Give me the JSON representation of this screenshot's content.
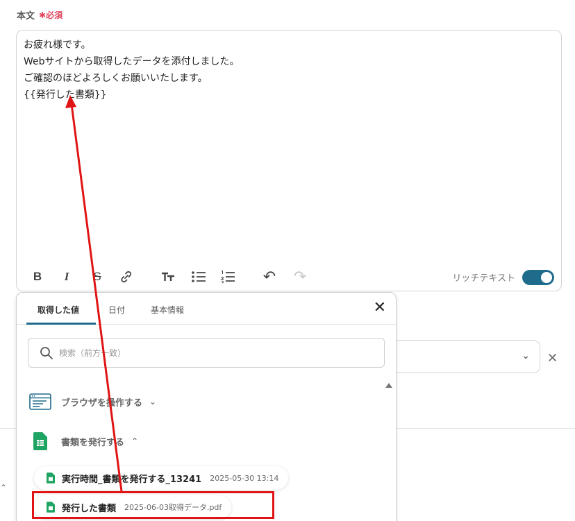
{
  "field": {
    "label": "本文",
    "required_mark": "✱",
    "required_text": "必須"
  },
  "editor": {
    "lines": [
      "お疲れ様です。",
      "Webサイトから取得したデータを添付しました。",
      "ご確認のほどよろしくお願いいたします。",
      "{{発行した書類}}"
    ],
    "rich_text_label": "リッチテキスト",
    "rich_text_enabled": true
  },
  "toolbar": {
    "bold": "B",
    "italic": "I",
    "strike": "S",
    "undo": "↶",
    "redo": "↷"
  },
  "panel": {
    "tabs": [
      {
        "label": "取得した値",
        "active": true
      },
      {
        "label": "日付",
        "active": false
      },
      {
        "label": "基本情報",
        "active": false
      }
    ],
    "close_glyph": "✕",
    "search_placeholder": "検索（前方一致）",
    "groups": [
      {
        "label": "ブラウザを操作する",
        "expanded": false,
        "icon": "browser-window-icon"
      },
      {
        "label": "書類を発行する",
        "expanded": true,
        "icon": "google-sheets-icon"
      }
    ],
    "items": [
      {
        "name": "実行時間_書類を発行する_13241",
        "value": "2025-05-30 13:14",
        "icon": "google-sheets-icon"
      },
      {
        "name": "発行した書類",
        "value": "2025-06-03取得データ.pdf",
        "icon": "google-sheets-icon",
        "highlighted": true
      }
    ],
    "chevron_down": "⌄",
    "chevron_up": "⌃"
  },
  "colors": {
    "accent": "#1f6b8c",
    "required": "#e0445b",
    "highlight": "#e01414",
    "sheets_green": "#1fa463"
  }
}
